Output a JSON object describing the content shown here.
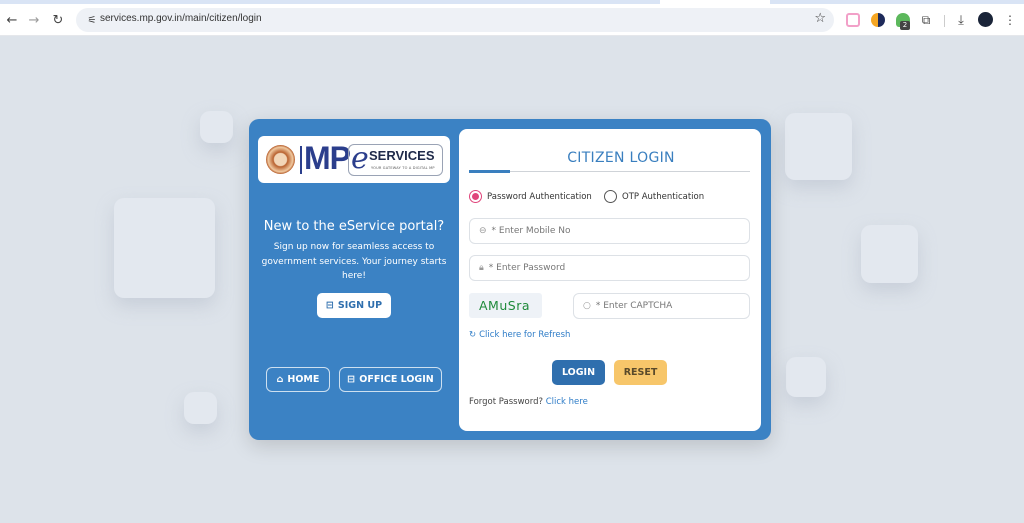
{
  "browser": {
    "url": "services.mp.gov.in/main/citizen/login",
    "extension_badge_count": "2",
    "icons": [
      "back-icon",
      "forward-icon",
      "reload-icon",
      "site-settings-icon",
      "bookmark-star-icon",
      "extension-icon",
      "downloads-icon",
      "profile-avatar",
      "menu-icon"
    ]
  },
  "brand": {
    "mp_text": "MP",
    "e_letter": "e",
    "services_text": "SERVICES",
    "tagline": "YOUR GATEWAY TO A DIGITAL MP"
  },
  "left": {
    "title": "New to the eService portal?",
    "description": "Sign up now for seamless access to government services. Your journey starts here!",
    "signup_label": "SIGN UP",
    "home_label": "HOME",
    "office_login_label": "OFFICE LOGIN"
  },
  "login": {
    "title": "CITIZEN LOGIN",
    "auth_options": [
      {
        "label": "Password Authentication",
        "selected": true
      },
      {
        "label": "OTP Authentication",
        "selected": false
      }
    ],
    "mobile_placeholder": "* Enter Mobile No",
    "password_placeholder": "* Enter Password",
    "captcha_text": "AMuSra",
    "captcha_placeholder": "* Enter CAPTCHA",
    "refresh_label": "Click here for Refresh",
    "login_label": "LOGIN",
    "reset_label": "RESET",
    "forgot_text": "Forgot Password?",
    "forgot_link": "Click here"
  },
  "colors": {
    "primary": "#3b82c4",
    "button_login": "#2f6fae",
    "button_reset": "#f7c66a",
    "captcha_text": "#1e8a3a",
    "radio_selected": "#e0457b"
  }
}
